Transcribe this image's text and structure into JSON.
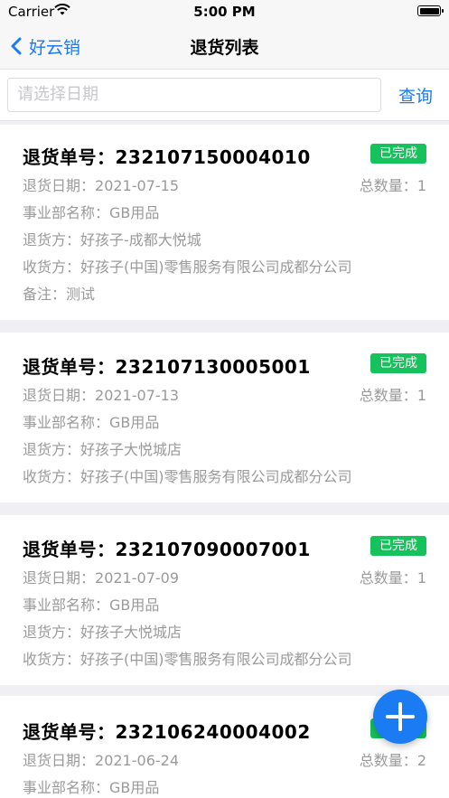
{
  "status_bar": {
    "carrier": "Carrier",
    "time": "5:00 PM"
  },
  "nav": {
    "back_label": "好云销",
    "title": "退货列表"
  },
  "search": {
    "placeholder": "请选择日期",
    "button_label": "查询"
  },
  "labels": {
    "order_no": "退货单号：",
    "date": "退货日期：",
    "dept": "事业部名称：",
    "returner": "退货方：",
    "receiver": "收货方：",
    "remark": "备注：",
    "qty": "总数量："
  },
  "orders": [
    {
      "order_no": "232107150004010",
      "status": "已完成",
      "date": "2021-07-15",
      "qty": "1",
      "dept": "GB用品",
      "returner": "好孩子-成都大悦城",
      "receiver": "好孩子(中国)零售服务有限公司成都分公司",
      "remark": "测试"
    },
    {
      "order_no": "232107130005001",
      "status": "已完成",
      "date": "2021-07-13",
      "qty": "1",
      "dept": "GB用品",
      "returner": "好孩子大悦城店",
      "receiver": "好孩子(中国)零售服务有限公司成都分公司"
    },
    {
      "order_no": "232107090007001",
      "status": "已完成",
      "date": "2021-07-09",
      "qty": "1",
      "dept": "GB用品",
      "returner": "好孩子大悦城店",
      "receiver": "好孩子(中国)零售服务有限公司成都分公司"
    },
    {
      "order_no": "232106240004002",
      "status": "已完成",
      "date": "2021-06-24",
      "qty": "2",
      "dept": "GB用品"
    }
  ],
  "colors": {
    "accent": "#1a7bf2",
    "status_done": "#16c25b",
    "muted_text": "#9a9a9a"
  },
  "icons": {
    "back": "chevron-left-icon",
    "fab": "plus-icon",
    "wifi": "wifi-icon",
    "battery": "battery-icon"
  }
}
